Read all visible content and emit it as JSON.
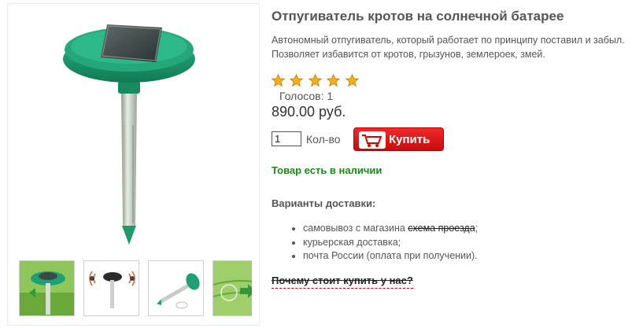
{
  "product": {
    "title": "Отпугиватель кротов на солнечной батарее",
    "description": "Автономный отпугиватель, который работает по принципу поставил и забыл. Позволяет избавится от кротов, грызунов, землероек, змей.",
    "rating": 5,
    "rating_max": 5,
    "votes_text": "Голосов: 1",
    "price": "890.00 руб.",
    "quantity_value": "1",
    "quantity_label": "Кол-во",
    "buy_label": "Купить",
    "stock_status": "Товар есть в наличии"
  },
  "delivery": {
    "title": "Варианты доставки:",
    "pickup_text": "самовывоз с магазина ",
    "pickup_link": "схема проезда",
    "pickup_suffix": ";",
    "courier": "курьерская доставка;",
    "post": "почта России (оплата при получении)."
  },
  "why_link": "Почему стоит купить у нас?",
  "colors": {
    "accent_green": "#1a8a1a",
    "buy_red": "#e01010",
    "device_green": "#1fa074",
    "star": "#f7b01a"
  },
  "gallery": {
    "thumbnails": [
      "thumb-field-photo",
      "thumb-device-with-waves",
      "thumb-device-lying",
      "thumb-field-with-arrow"
    ]
  }
}
